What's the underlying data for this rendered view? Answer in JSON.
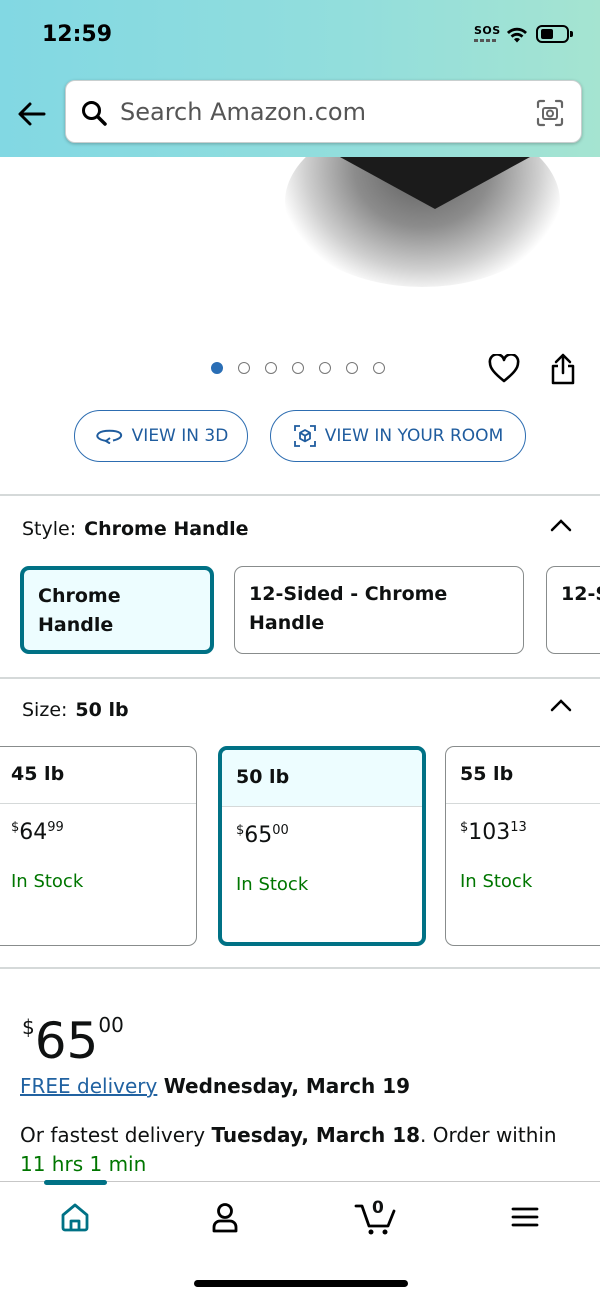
{
  "status_bar": {
    "time": "12:59",
    "sos": "SOS"
  },
  "search": {
    "placeholder": "Search Amazon.com"
  },
  "gallery": {
    "total_images": 7,
    "active_index": 0
  },
  "view_buttons": {
    "view_3d": "VIEW IN 3D",
    "view_room": "VIEW IN YOUR ROOM"
  },
  "style": {
    "label": "Style:",
    "selected": "Chrome Handle",
    "options": [
      "Chrome Handle",
      "12-Sided - Chrome Handle",
      "12-S"
    ]
  },
  "size": {
    "label": "Size:",
    "selected": "50 lb",
    "options": [
      {
        "name": "45 lb",
        "currency": "$",
        "whole": "64",
        "cents": "99",
        "stock": "In Stock"
      },
      {
        "name": "50 lb",
        "currency": "$",
        "whole": "65",
        "cents": "00",
        "stock": "In Stock"
      },
      {
        "name": "55 lb",
        "currency": "$",
        "whole": "103",
        "cents": "13",
        "stock": "In Stock"
      }
    ]
  },
  "price": {
    "currency": "$",
    "whole": "65",
    "cents": "00"
  },
  "delivery": {
    "free_link": "FREE delivery",
    "free_date": "Wednesday, March 19",
    "fast_prefix": "Or fastest delivery",
    "fast_date": "Tuesday, March 18",
    "order_within": ". Order within",
    "countdown": "11 hrs 1 min"
  },
  "bottom_nav": {
    "cart_count": "0"
  },
  "colors": {
    "accent": "#007185",
    "link": "#2162a1",
    "stock": "#007600"
  }
}
